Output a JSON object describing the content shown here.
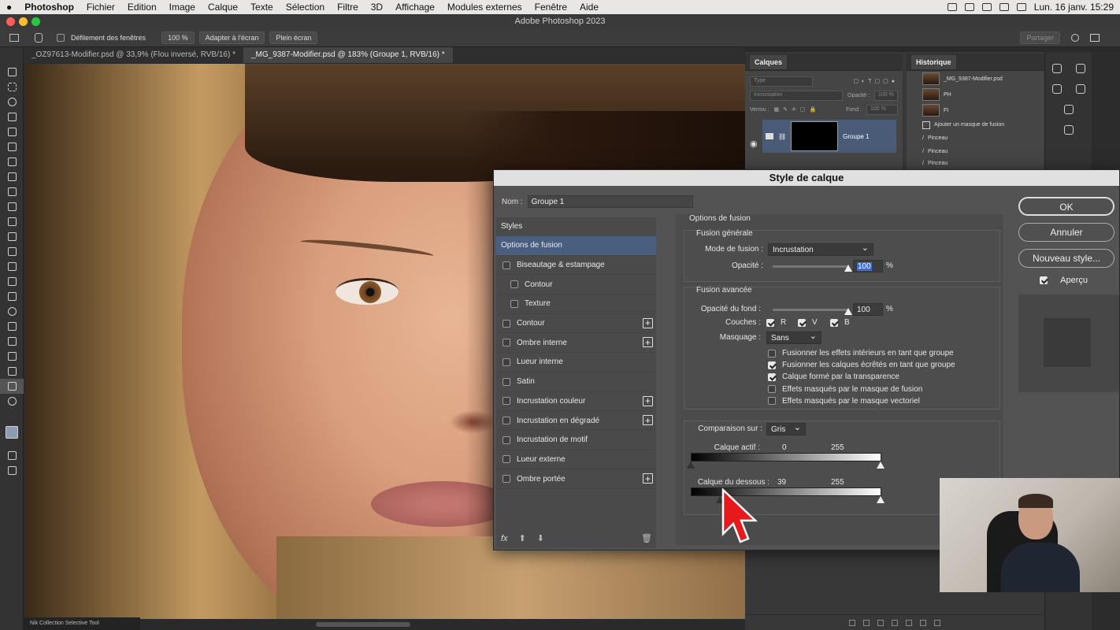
{
  "menubar": {
    "app": "Photoshop",
    "items": [
      "Fichier",
      "Edition",
      "Image",
      "Calque",
      "Texte",
      "Sélection",
      "Filtre",
      "3D",
      "Affichage",
      "Modules externes",
      "Fenêtre",
      "Aide"
    ],
    "clock": "Lun. 16 janv.  15:29"
  },
  "window": {
    "title": "Adobe Photoshop 2023"
  },
  "options_bar": {
    "scroll_all": "Défilement des fenêtres",
    "zoom": "100 %",
    "fit": "Adapter à l'écran",
    "fullscreen": "Plein écran",
    "share": "Partager"
  },
  "doc_tabs": [
    "_OZ97613-Modifier.psd @ 33,9% (Flou inversé, RVB/16) *",
    "_MG_9387-Modifier.psd @ 183% (Groupe 1, RVB/16) *"
  ],
  "layers_panel": {
    "tab": "Calques",
    "filter": "Type",
    "blend": "Incrustation",
    "opacity_label": "Opacité :",
    "opacity_value": "100 %",
    "lock_label": "Verrou :",
    "fill_label": "Fond :",
    "fill_value": "100 %",
    "layer_name": "Groupe 1"
  },
  "history_panel": {
    "tab": "Historique",
    "items": [
      "_MG_9387-Modifier.psd",
      "PH",
      "FI",
      "Ajouter un masque de fusion",
      "Pinceau",
      "Pinceau",
      "Pinceau"
    ]
  },
  "status": {
    "plugin": "Nik Collection Selective Tool"
  },
  "dialog": {
    "title": "Style de calque",
    "name_label": "Nom :",
    "name_value": "Groupe 1",
    "styles_header": "Styles",
    "styles": [
      {
        "label": "Options de fusion",
        "selected": true,
        "checkbox": false,
        "plus": false,
        "sub": false
      },
      {
        "label": "Biseautage & estampage",
        "checkbox": true,
        "plus": false,
        "sub": false
      },
      {
        "label": "Contour",
        "checkbox": true,
        "plus": false,
        "sub": true
      },
      {
        "label": "Texture",
        "checkbox": true,
        "plus": false,
        "sub": true
      },
      {
        "label": "Contour",
        "checkbox": true,
        "plus": true,
        "sub": false
      },
      {
        "label": "Ombre interne",
        "checkbox": true,
        "plus": true,
        "sub": false
      },
      {
        "label": "Lueur interne",
        "checkbox": true,
        "plus": false,
        "sub": false
      },
      {
        "label": "Satin",
        "checkbox": true,
        "plus": false,
        "sub": false
      },
      {
        "label": "Incrustation couleur",
        "checkbox": true,
        "plus": true,
        "sub": false
      },
      {
        "label": "Incrustation en dégradé",
        "checkbox": true,
        "plus": true,
        "sub": false
      },
      {
        "label": "Incrustation de motif",
        "checkbox": true,
        "plus": false,
        "sub": false
      },
      {
        "label": "Lueur externe",
        "checkbox": true,
        "plus": false,
        "sub": false
      },
      {
        "label": "Ombre portée",
        "checkbox": true,
        "plus": true,
        "sub": false
      }
    ],
    "fx_label": "fx",
    "options_title": "Options de fusion",
    "general": {
      "title": "Fusion générale",
      "mode_label": "Mode de fusion :",
      "mode_value": "Incrustation",
      "opacity_label": "Opacité :",
      "opacity_value": "100",
      "opacity_fraction": 1.0,
      "pct": "%"
    },
    "advanced": {
      "title": "Fusion avancée",
      "fill_label": "Opacité du fond :",
      "fill_value": "100",
      "fill_fraction": 1.0,
      "pct": "%",
      "channels_label": "Couches :",
      "channels": [
        "R",
        "V",
        "B"
      ],
      "knockout_label": "Masquage :",
      "knockout_value": "Sans",
      "checks": [
        {
          "label": "Fusionner les effets intérieurs en tant que groupe",
          "on": false
        },
        {
          "label": "Fusionner les calques écrêtés en tant que groupe",
          "on": true
        },
        {
          "label": "Calque formé par la transparence",
          "on": true
        },
        {
          "label": "Effets masqués par le masque de fusion",
          "on": false
        },
        {
          "label": "Effets masqués par le masque vectoriel",
          "on": false
        }
      ]
    },
    "blendif": {
      "label": "Comparaison sur :",
      "value": "Gris",
      "this_layer_label": "Calque actif :",
      "this_layer_low": "0",
      "this_layer_high": "255",
      "below_label": "Calque du dessous :",
      "below_low": "39",
      "below_high": "255"
    },
    "buttons": {
      "ok": "OK",
      "cancel": "Annuler",
      "new_style": "Nouveau style..."
    },
    "preview_label": "Aperçu"
  }
}
